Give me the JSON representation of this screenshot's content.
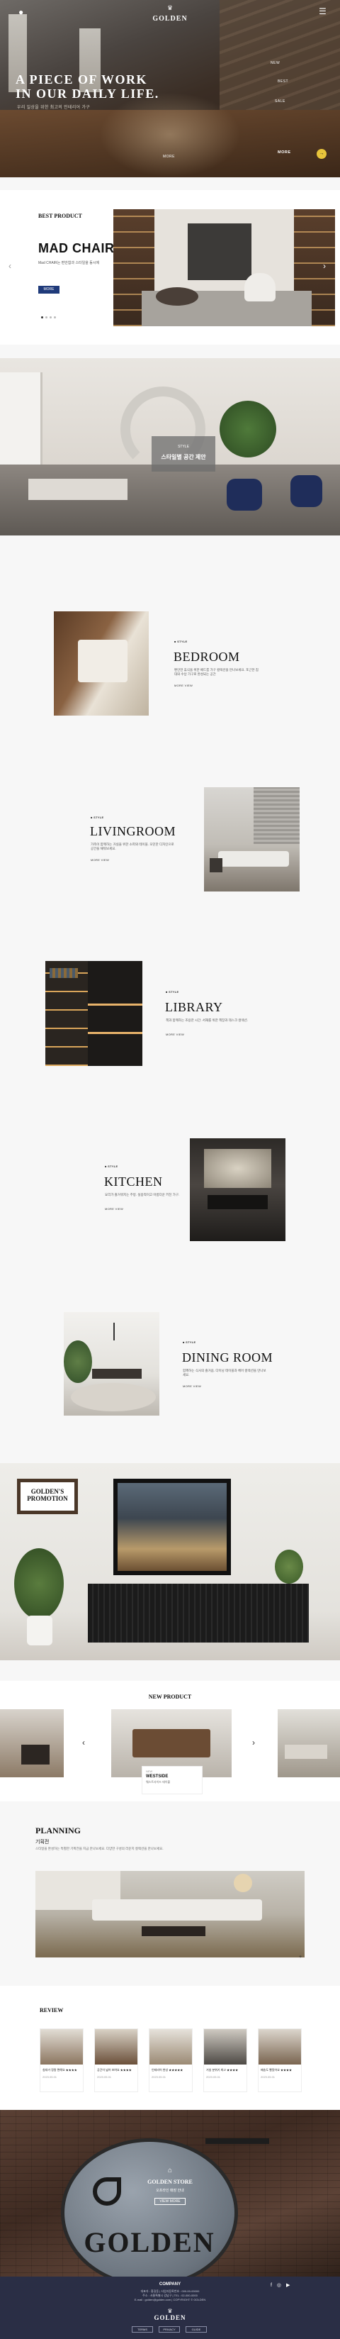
{
  "header": {
    "logo_mark": "♛",
    "logo_text": "GOLDEN",
    "user_icon": "user-icon",
    "menu_icon": "hamburger-icon"
  },
  "hero": {
    "headline_1": "A PIECE OF WORK",
    "headline_2": "IN OUR DAILY LIFE.",
    "subline": "우리 일상을 위한 최고의 인테리어 가구",
    "nav_items": [
      "NEW",
      "BEST",
      "SALE"
    ],
    "more_label": "MORE",
    "cta_label": "MORE",
    "cta_icon": "arrow-right-icon"
  },
  "best": {
    "section_label": "BEST PRODUCT",
    "title": "MAD CHAIR",
    "desc": "Mad CHAIR는 편안함과 스타일을 동시에 ",
    "button": "MORE"
  },
  "living_banner": {
    "tag": "STYLE",
    "text": "스타일별 공간 제안"
  },
  "rooms": [
    {
      "tag": "■ STYLE",
      "title": "BEDROOM",
      "desc": "편안한 휴식을 위한 베드룸 가구 컬렉션을 만나보세요. 포근한 침대와 수납 가구로 완성되는 공간",
      "more": "MORE VIEW"
    },
    {
      "tag": "■ STYLE",
      "title": "LIVINGROOM",
      "desc": "가족이 함께하는 거실을 위한 소파와 테이블. 모던한 디자인으로 공간을 채워보세요.",
      "more": "MORE VIEW"
    },
    {
      "tag": "■ STYLE",
      "title": "LIBRARY",
      "desc": "책과 함께하는 조용한 시간. 서재를 위한 책장과 데스크 컬렉션.",
      "more": "MORE VIEW"
    },
    {
      "tag": "■ STYLE",
      "title": "KITCHEN",
      "desc": "요리가 즐거워지는 주방. 실용적이고 아름다운 키친 가구.",
      "more": "MORE VIEW"
    },
    {
      "tag": "■ STYLE",
      "title": "DINING ROOM",
      "desc": "함께하는 식사의 즐거움. 다이닝 테이블과 체어 컬렉션을 만나보세요.",
      "more": "MORE VIEW"
    }
  ],
  "promotion": {
    "line1": "GOLDEN'S",
    "line2": "PROMOTION"
  },
  "new_product": {
    "title": "NEW PRODUCT",
    "card_tag": "NEW",
    "card_name": "WESTSIDE",
    "card_desc": "웨스트사이드 테이블"
  },
  "planning": {
    "title": "PLANNING",
    "subtitle": "기획전",
    "desc": "스타일을 완성하는 특별한 기획전을 지금 만나보세요. 다양한 구성의 라운지 컬렉션을 만나보세요."
  },
  "review": {
    "title": "REVIEW",
    "cards": [
      {
        "title": "침대가 정말 편해요 ★★★★",
        "meta": "2023.05.01"
      },
      {
        "title": "공간이 넓어 보여요 ★★★★",
        "meta": "2023.05.01"
      },
      {
        "title": "인테리어 완성 ★★★★★",
        "meta": "2023.05.01"
      },
      {
        "title": "거실 분위기 최고 ★★★★",
        "meta": "2023.05.01"
      },
      {
        "title": "배송도 빨랐어요 ★★★★",
        "meta": "2023.05.01"
      }
    ]
  },
  "store": {
    "sign_text": "GOLDEN",
    "label": "GOLDEN STORE",
    "sub": "오프라인 매장 안내",
    "button": "VIEW MORE"
  },
  "footer": {
    "company": "COMPANY",
    "line1": "대표자 : 홍길동 | 사업자등록번호 : 000-00-00000",
    "line2": "주소 : 서울특별시 강남구 | TEL : 02-000-0000",
    "line3": "E-mail : golden@golden.com | COPYRIGHT © GOLDEN",
    "social": [
      "f",
      "◎",
      "▶"
    ],
    "logo_mark": "♛",
    "logo_text": "GOLDEN",
    "buttons": [
      "TERMS",
      "PRIVACY",
      "GUIDE"
    ]
  }
}
